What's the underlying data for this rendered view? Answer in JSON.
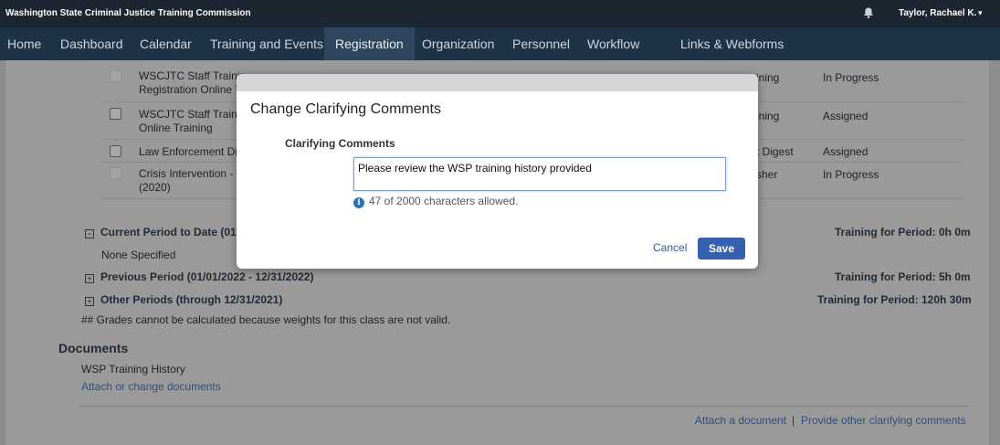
{
  "topbar": {
    "org": "Washington State Criminal Justice Training Commission",
    "bell_icon": "bell-icon",
    "user": "Taylor, Rachael K.",
    "caret": "▾"
  },
  "nav": {
    "items": [
      "Home",
      "Dashboard",
      "Calendar",
      "Training and Events",
      "Registration",
      "Organization",
      "Personnel",
      "Workflow",
      "Links & Webforms"
    ],
    "active": "Registration"
  },
  "list": {
    "rows": [
      {
        "name": "WSCJTC Staff Trainir\nRegistration Online T",
        "type": "ining",
        "status": "In Progress"
      },
      {
        "name": "WSCJTC Staff Trainir\nOnline Training",
        "type": "ining",
        "status": "Assigned"
      },
      {
        "name": "Law Enforcement Di",
        "type": "t Digest",
        "status": "Assigned"
      },
      {
        "name": "Crisis Intervention - .\n(2020)",
        "type": "sher",
        "status": "In Progress"
      }
    ]
  },
  "periods": {
    "current_label": "Current Period to Date (01/(",
    "current_total": "Training for Period: 0h 0m",
    "none": "None Specified",
    "previous_label": "Previous Period (01/01/2022 - 12/31/2022)",
    "previous_total": "Training for Period: 5h 0m",
    "other_label": "Other Periods (through 12/31/2021)",
    "other_total": "Training for Period: 120h 30m",
    "grades_note": "## Grades cannot be calculated because weights for this class are not valid."
  },
  "documents": {
    "heading": "Documents",
    "item": "WSP Training History",
    "attach_change": "Attach or change documents"
  },
  "footer": {
    "attach": "Attach a document",
    "divider": "|",
    "clarify": "Provide other clarifying comments"
  },
  "modal": {
    "title": "Change Clarifying Comments",
    "field_label": "Clarifying Comments",
    "value": "Please review the WSP training history provided",
    "hint": "47  of 2000 characters allowed.",
    "info_icon": "i",
    "cancel": "Cancel",
    "save": "Save"
  }
}
